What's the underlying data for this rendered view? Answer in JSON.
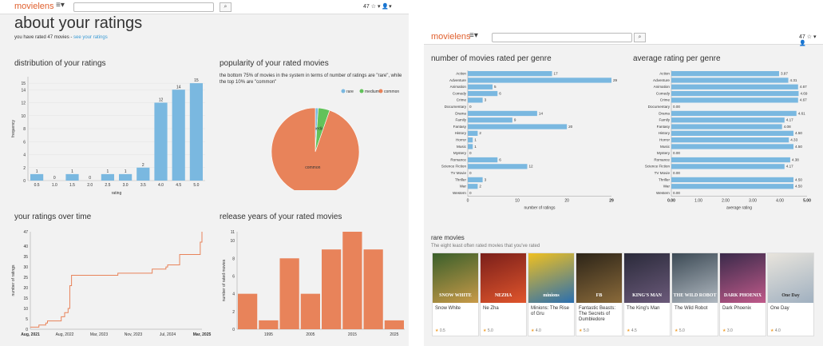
{
  "colors": {
    "accent": "#e0602e",
    "blue": "#7ab8e0",
    "orange": "#e8835a",
    "green": "#62c25a",
    "link": "#3a9bd5"
  },
  "left": {
    "nav": {
      "logo": "movielens",
      "menu_icon": "hamburger-menu-icon",
      "search_value": "",
      "top_right": "47 ☆ ▾   👤▾"
    },
    "title": "about your ratings",
    "subtitle_prefix": "you have rated 47 movies - ",
    "subtitle_link": "see your ratings",
    "dist_title": "distribution of your ratings",
    "popularity_title": "popularity of your rated movies",
    "popularity_desc": "the bottom 75% of movies in the system in terms of number of ratings are \"rare\", while the top 10% are \"common\"",
    "over_time_title": "your ratings over time",
    "release_title": "release years of your rated movies"
  },
  "right": {
    "nav": {
      "logo": "movielens",
      "menu_icon": "hamburger-menu-icon",
      "search_value": "",
      "top_right": "47 ☆ ▾   👤"
    },
    "genre_count_title": "number of movies rated per genre",
    "genre_avg_title": "average rating per genre",
    "rare_title": "rare movies",
    "rare_sub": "The eight least often rated movies that you've rated",
    "rare_movies": [
      {
        "title": "Snow White",
        "rating": "0.5"
      },
      {
        "title": "Ne Zha",
        "rating": "5.0"
      },
      {
        "title": "Minions: The Rise of Gru",
        "rating": "4.0"
      },
      {
        "title": "Fantastic Beasts: The Secrets of Dumbledore",
        "rating": "5.0"
      },
      {
        "title": "The King's Man",
        "rating": "4.5"
      },
      {
        "title": "The Wild Robot",
        "rating": "5.0"
      },
      {
        "title": "Dark Phoenix",
        "rating": "3.0"
      },
      {
        "title": "One Day",
        "rating": "4.0"
      }
    ]
  },
  "chart_data": [
    {
      "type": "bar",
      "title": "distribution of your ratings",
      "xlabel": "rating",
      "ylabel": "frequency",
      "categories": [
        "0.5",
        "1.0",
        "1.5",
        "2.0",
        "2.5",
        "3.0",
        "3.5",
        "4.0",
        "4.5",
        "5.0"
      ],
      "values": [
        1,
        0,
        1,
        0,
        1,
        1,
        2,
        12,
        14,
        15
      ],
      "ylim": [
        0,
        16
      ],
      "yticks": [
        0,
        2,
        4,
        6,
        8,
        10,
        12,
        14,
        15
      ]
    },
    {
      "type": "pie",
      "title": "popularity of your rated movies",
      "legend": [
        "rare",
        "medium",
        "common"
      ],
      "legend_position": "top-right",
      "values": [
        0.5,
        2,
        44.5
      ]
    },
    {
      "type": "line",
      "title": "your ratings over time",
      "ylabel": "number of ratings",
      "xticks": [
        "Aug, 2021",
        "Aug, 2022",
        "Mar, 2023",
        "Nov, 2023",
        "Jul, 2024",
        "Mar, 2025"
      ],
      "yticks": [
        0,
        5,
        10,
        15,
        20,
        25,
        30,
        35,
        40,
        47
      ],
      "ylim": [
        0,
        47
      ],
      "points": [
        [
          0.0,
          1
        ],
        [
          0.05,
          2
        ],
        [
          0.09,
          3
        ],
        [
          0.1,
          4
        ],
        [
          0.17,
          4
        ],
        [
          0.18,
          6
        ],
        [
          0.2,
          8
        ],
        [
          0.22,
          10
        ],
        [
          0.23,
          21
        ],
        [
          0.24,
          26
        ],
        [
          0.5,
          26
        ],
        [
          0.51,
          27
        ],
        [
          0.7,
          27
        ],
        [
          0.71,
          29
        ],
        [
          0.79,
          30
        ],
        [
          0.8,
          31
        ],
        [
          0.86,
          31
        ],
        [
          0.87,
          36
        ],
        [
          0.98,
          36
        ],
        [
          0.99,
          42
        ],
        [
          1.0,
          47
        ]
      ]
    },
    {
      "type": "bar",
      "title": "release years of your rated movies",
      "ylabel": "number of rated movies",
      "xticks": [
        "1995",
        "2005",
        "2015",
        "2025"
      ],
      "values": [
        4,
        1,
        8,
        4,
        9,
        11,
        9,
        1
      ],
      "ylim": [
        0,
        11
      ],
      "yticks": [
        0,
        2,
        4,
        6,
        8,
        10,
        11
      ]
    },
    {
      "type": "bar",
      "orientation": "horizontal",
      "title": "number of movies rated per genre",
      "xlabel": "number of ratings",
      "categories": [
        "Action",
        "Adventure",
        "Animation",
        "Comedy",
        "Crime",
        "Documentary",
        "Drama",
        "Family",
        "Fantasy",
        "History",
        "Horror",
        "Music",
        "Mystery",
        "Romance",
        "Science Fiction",
        "TV Movie",
        "Thriller",
        "War",
        "Western"
      ],
      "values": [
        17,
        29,
        5,
        6,
        3,
        0,
        14,
        9,
        20,
        2,
        1,
        1,
        0,
        6,
        12,
        0,
        3,
        2,
        0
      ],
      "xlim": [
        0,
        29
      ],
      "xticks": [
        0,
        10,
        20,
        29
      ]
    },
    {
      "type": "bar",
      "orientation": "horizontal",
      "title": "average rating per genre",
      "xlabel": "average rating",
      "categories": [
        "Action",
        "Adventure",
        "Animation",
        "Comedy",
        "Crime",
        "Documentary",
        "Drama",
        "Family",
        "Fantasy",
        "History",
        "Horror",
        "Music",
        "Mystery",
        "Romance",
        "Science Fiction",
        "TV Movie",
        "Thriller",
        "War",
        "Western"
      ],
      "values": [
        3.97,
        4.31,
        4.67,
        4.69,
        4.67,
        0.0,
        4.61,
        4.17,
        4.08,
        4.5,
        4.33,
        4.5,
        0.0,
        4.38,
        4.17,
        0.0,
        4.5,
        4.5,
        0.0
      ],
      "labels": [
        "3.97",
        "4.31",
        "4.67",
        "4.69",
        "4.67",
        "0.00",
        "4.61",
        "4.17",
        "4.08",
        "4.50",
        "4.33",
        "4.50",
        "0.00",
        "4.38",
        "4.17",
        "0.00",
        "4.50",
        "4.50",
        "0.00"
      ],
      "xlim": [
        0,
        5
      ],
      "xticks": [
        "0.00",
        "1.00",
        "2.00",
        "3.00",
        "4.00",
        "5.00"
      ]
    }
  ]
}
